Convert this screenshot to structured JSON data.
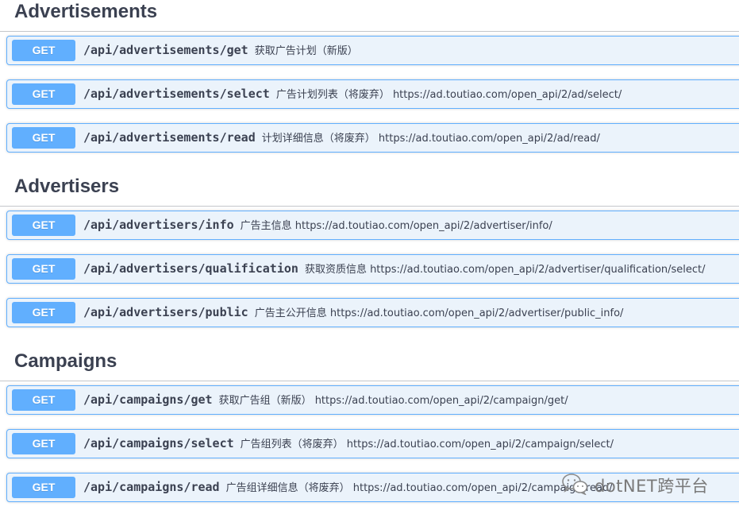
{
  "colors": {
    "get_accent": "#61affe",
    "get_background": "#ebf3fb",
    "text": "#3b4151"
  },
  "sections": [
    {
      "title": "Advertisements",
      "operations": [
        {
          "method": "GET",
          "path": "/api/advertisements/get",
          "summary": "获取广告计划（新版）"
        },
        {
          "method": "GET",
          "path": "/api/advertisements/select",
          "summary": "广告计划列表（将废弃） https://ad.toutiao.com/open_api/2/ad/select/"
        },
        {
          "method": "GET",
          "path": "/api/advertisements/read",
          "summary": "计划详细信息（将废弃） https://ad.toutiao.com/open_api/2/ad/read/"
        }
      ]
    },
    {
      "title": "Advertisers",
      "operations": [
        {
          "method": "GET",
          "path": "/api/advertisers/info",
          "summary": "广告主信息 https://ad.toutiao.com/open_api/2/advertiser/info/"
        },
        {
          "method": "GET",
          "path": "/api/advertisers/qualification",
          "summary": "获取资质信息 https://ad.toutiao.com/open_api/2/advertiser/qualification/select/"
        },
        {
          "method": "GET",
          "path": "/api/advertisers/public",
          "summary": "广告主公开信息 https://ad.toutiao.com/open_api/2/advertiser/public_info/"
        }
      ]
    },
    {
      "title": "Campaigns",
      "operations": [
        {
          "method": "GET",
          "path": "/api/campaigns/get",
          "summary": "获取广告组（新版） https://ad.toutiao.com/open_api/2/campaign/get/"
        },
        {
          "method": "GET",
          "path": "/api/campaigns/select",
          "summary": "广告组列表（将废弃） https://ad.toutiao.com/open_api/2/campaign/select/"
        },
        {
          "method": "GET",
          "path": "/api/campaigns/read",
          "summary": "广告组详细信息（将废弃） https://ad.toutiao.com/open_api/2/campaign/read/"
        }
      ]
    }
  ],
  "watermark": {
    "icon": "wechat-icon",
    "text": "dotNET跨平台"
  }
}
